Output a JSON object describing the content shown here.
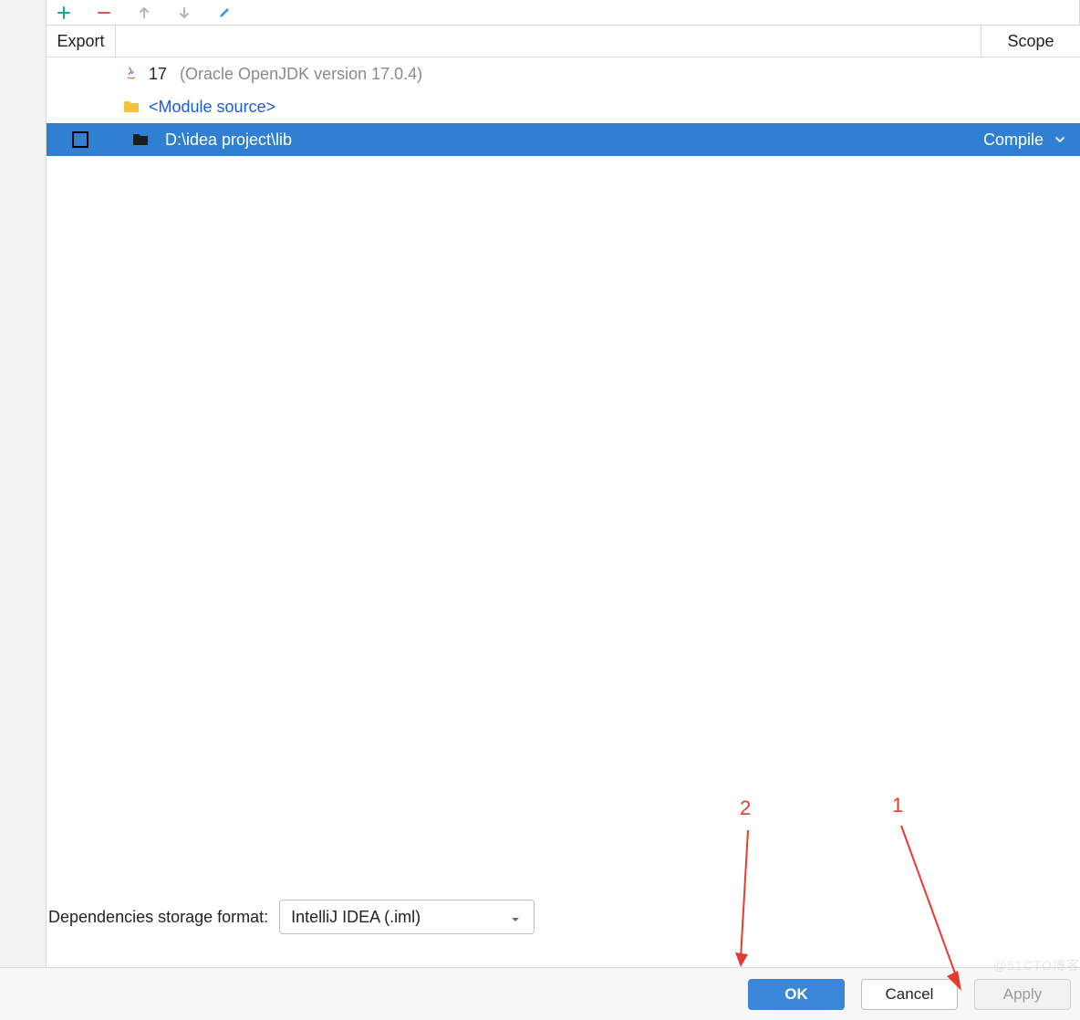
{
  "toolbar": {
    "add": "+",
    "remove": "−",
    "up": "↑",
    "down": "↓",
    "edit": "✎"
  },
  "headers": {
    "export": "Export",
    "scope": "Scope"
  },
  "rows": {
    "sdk": {
      "version": "17",
      "desc": "(Oracle OpenJDK version 17.0.4)"
    },
    "module_source": "<Module source>",
    "lib": {
      "path": "D:\\idea project\\lib",
      "scope": "Compile"
    }
  },
  "storage": {
    "label": "Dependencies storage format:",
    "value": "IntelliJ IDEA (.iml)"
  },
  "footer": {
    "ok": "OK",
    "cancel": "Cancel",
    "apply": "Apply"
  },
  "annotations": {
    "n1": "1",
    "n2": "2"
  },
  "watermark": "@51CTO博客"
}
